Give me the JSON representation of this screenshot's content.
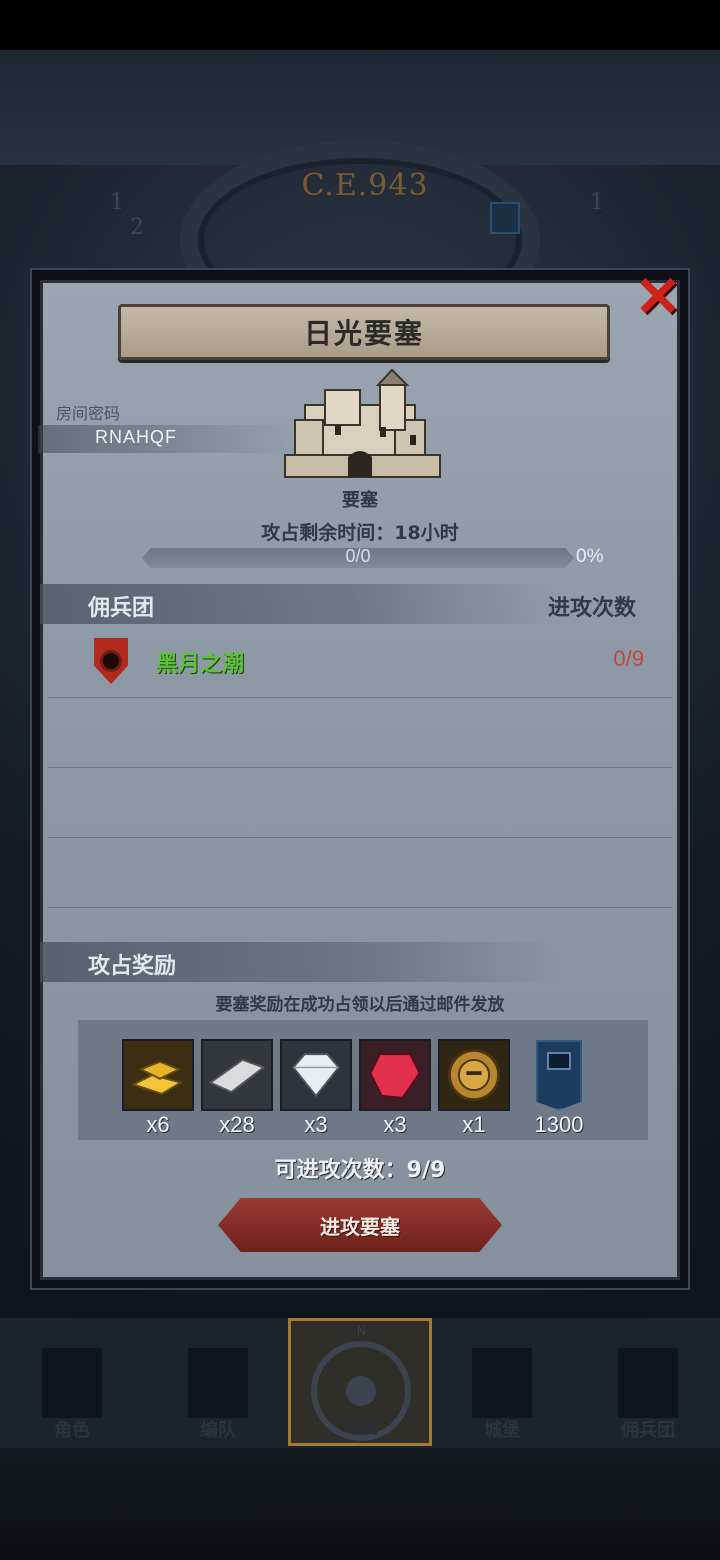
{
  "background": {
    "era_label": "C.E.943"
  },
  "modal": {
    "title": "日光要塞",
    "room": {
      "label": "房间密码",
      "code": "RNAHQF"
    },
    "building": {
      "type_label": "要塞",
      "icon": "castle-icon"
    },
    "siege": {
      "remaining_time": "攻占剩余时间：18小时",
      "progress_text": "0/0",
      "progress_percent": "0%",
      "progress_fraction": 0
    },
    "mercenaries": {
      "header": "佣兵团",
      "attacks_header": "进攻次数",
      "rows": [
        {
          "name": "黑月之潮",
          "count": "0/9",
          "icon": "red-shield-icon"
        }
      ]
    },
    "rewards": {
      "header": "攻占奖励",
      "note": "要塞奖励在成功占领以后通过邮件发放",
      "items": [
        {
          "icon": "gold-bars-icon",
          "qty": "x6"
        },
        {
          "icon": "silver-ingot-icon",
          "qty": "x28"
        },
        {
          "icon": "diamond-icon",
          "qty": "x3"
        },
        {
          "icon": "ruby-icon",
          "qty": "x3"
        },
        {
          "icon": "golden-helmet-icon",
          "qty": "x1"
        },
        {
          "icon": "guild-banner-icon",
          "qty": "1300"
        }
      ]
    },
    "attack_count": "可进攻次数：9/9",
    "attack_button": "进攻要塞",
    "close_icon": "close-icon"
  },
  "nav": {
    "items": [
      {
        "label": "角色",
        "icon": "knight-icon",
        "active": false
      },
      {
        "label": "编队",
        "icon": "helmet-icon",
        "active": false
      },
      {
        "label": "地图",
        "icon": "compass-icon",
        "active": true
      },
      {
        "label": "城堡",
        "icon": "castle-icon",
        "active": false
      },
      {
        "label": "佣兵团",
        "icon": "mercenary-icon",
        "active": false
      }
    ]
  },
  "colors": {
    "accent_red": "#d0201a",
    "merc_name_green": "#5bc23a",
    "count_red": "#c8453c",
    "active_nav_gold": "#a57a32"
  }
}
